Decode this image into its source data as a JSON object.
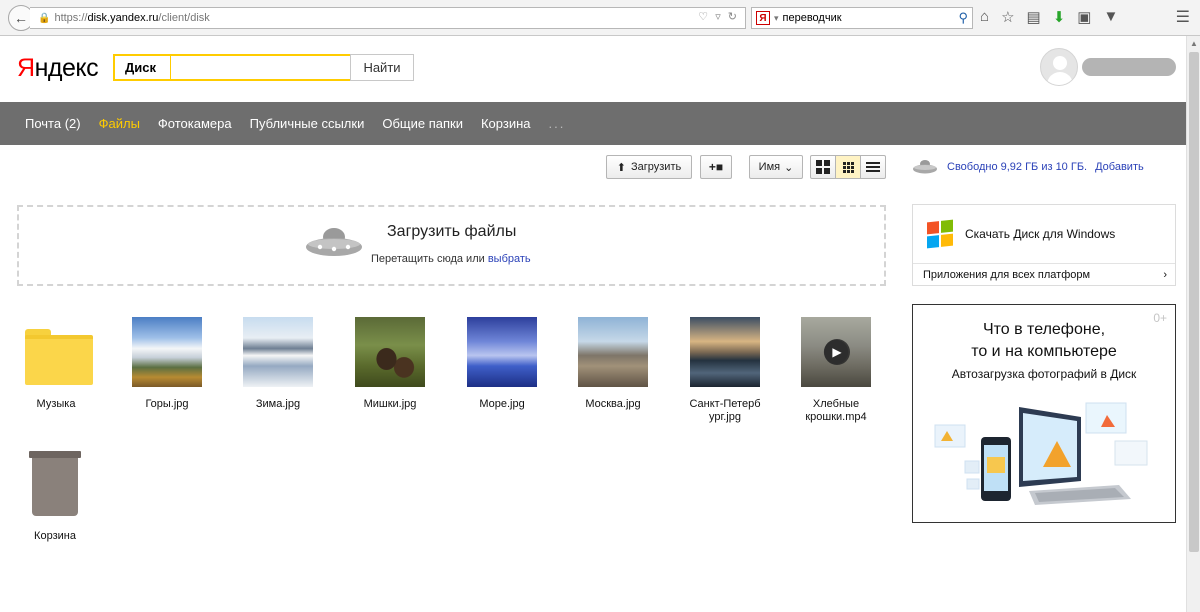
{
  "browser": {
    "url_prefix": "https://",
    "url_host": "disk.yandex.ru",
    "url_path": "/client/disk",
    "search_value": "переводчик",
    "search_engine_badge": "Я"
  },
  "header": {
    "logo_first": "Я",
    "logo_rest": "ндекс",
    "service_label": "Диск",
    "search_placeholder": "",
    "find_button": "Найти"
  },
  "nav": {
    "items": [
      "Почта (2)",
      "Файлы",
      "Фотокамера",
      "Публичные ссылки",
      "Общие папки",
      "Корзина"
    ],
    "more": "...",
    "active_index": 1,
    "active_color": "#ffcc00"
  },
  "toolbar": {
    "upload_label": "Загрузить",
    "new_folder_label": "+",
    "sort_label": "Имя",
    "active_view": "grid-small"
  },
  "dropzone": {
    "title": "Загрузить файлы",
    "subtitle": "Перетащить сюда или",
    "link": "выбрать"
  },
  "files": [
    {
      "name": "Музыка",
      "type": "folder"
    },
    {
      "name": "Горы.jpg",
      "type": "image"
    },
    {
      "name": "Зима.jpg",
      "type": "image"
    },
    {
      "name": "Мишки.jpg",
      "type": "image"
    },
    {
      "name": "Море.jpg",
      "type": "image"
    },
    {
      "name": "Москва.jpg",
      "type": "image"
    },
    {
      "name": "Санкт-Петербург.jpg",
      "type": "image"
    },
    {
      "name": "Хлебные крошки.mp4",
      "type": "video"
    },
    {
      "name": "Корзина",
      "type": "trash"
    }
  ],
  "sidebar": {
    "space_text": "Свободно 9,92 ГБ из 10 ГБ.",
    "add_link": "Добавить",
    "download_label": "Скачать Диск для Windows",
    "all_platforms": "Приложения для всех платформ",
    "promo_age": "0+",
    "promo_title_line1": "Что в телефоне,",
    "promo_title_line2": "то и на компьютере",
    "promo_subtitle": "Автозагрузка фотографий в Диск"
  },
  "colors": {
    "brand_yellow": "#ffcc00",
    "link_blue": "#2b42b8",
    "nav_bg": "#6e6e6e"
  }
}
